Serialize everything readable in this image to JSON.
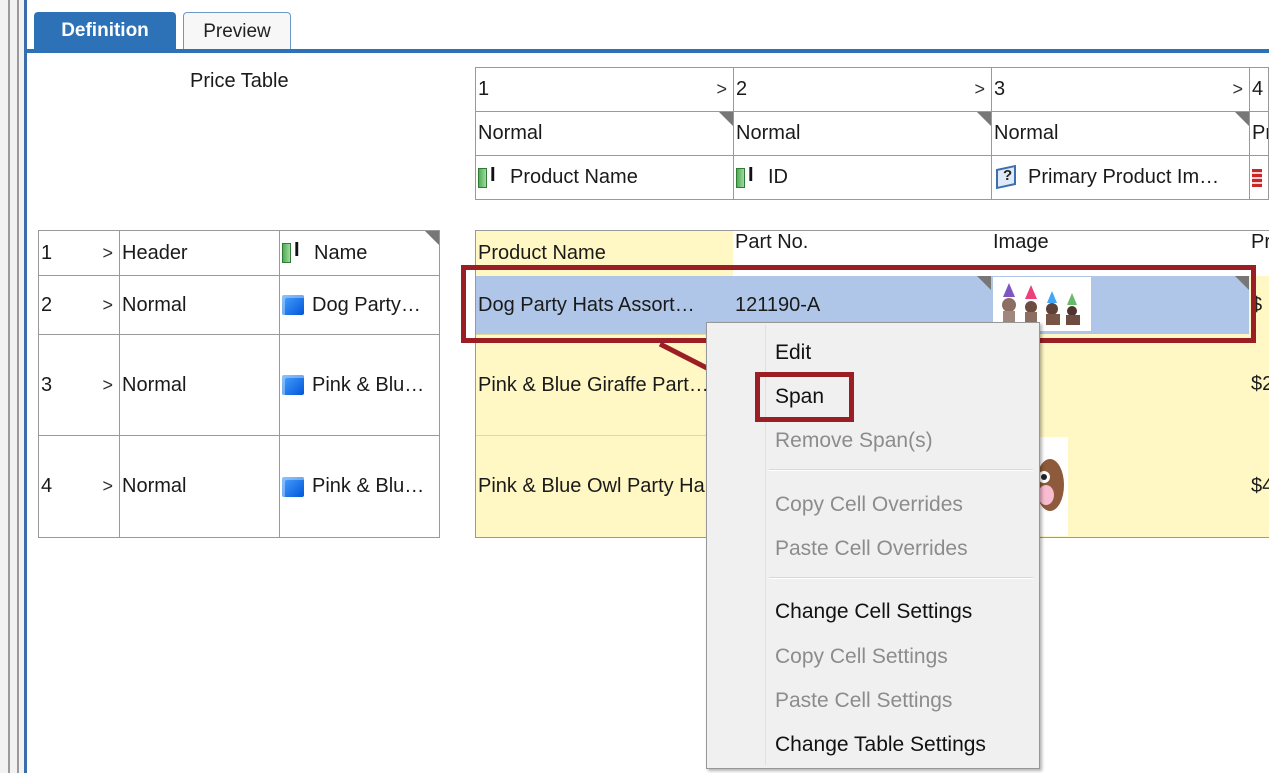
{
  "tabs": [
    {
      "label": "Definition",
      "active": true
    },
    {
      "label": "Preview",
      "active": false
    }
  ],
  "price_table_label": "Price Table",
  "columns": [
    {
      "num": "1",
      "style": "Normal",
      "field": "Product Name",
      "field_icon": "text-field-icon"
    },
    {
      "num": "2",
      "style": "Normal",
      "field": "ID",
      "field_icon": "text-field-icon"
    },
    {
      "num": "3",
      "style": "Normal",
      "field": "Primary Product Im…",
      "field_icon": "image-field-icon"
    },
    {
      "num": "4",
      "style": "Pr",
      "field": "",
      "field_icon": "table-icon"
    }
  ],
  "row_defs": [
    {
      "num": "1",
      "style": "Header",
      "name": "Name",
      "icon": "text-field-icon"
    },
    {
      "num": "2",
      "style": "Normal",
      "name": "Dog Party…",
      "icon": "cube-icon"
    },
    {
      "num": "3",
      "style": "Normal",
      "name": "Pink & Blu…",
      "icon": "cube-icon"
    },
    {
      "num": "4",
      "style": "Normal",
      "name": "Pink & Blu…",
      "icon": "cube-icon"
    }
  ],
  "grid": {
    "header": [
      "Product Name",
      "Part No.",
      "Image",
      "Pr"
    ],
    "rows": [
      [
        "Dog Party Hats Assort…",
        "121190-A",
        "",
        "$"
      ],
      [
        "Pink & Blue Giraffe Part…",
        "",
        "",
        "$2"
      ],
      [
        "Pink & Blue Owl Party Ha",
        "",
        "",
        "$4"
      ]
    ]
  },
  "context_menu": {
    "items": [
      {
        "label": "Edit",
        "enabled": true
      },
      {
        "label": "Span",
        "enabled": true
      },
      {
        "label": "Remove Span(s)",
        "enabled": false
      },
      {
        "label": "Copy Cell Overrides",
        "enabled": false
      },
      {
        "label": "Paste Cell Overrides",
        "enabled": false
      },
      {
        "label": "Change Cell Settings",
        "enabled": true
      },
      {
        "label": "Copy Cell Settings",
        "enabled": false
      },
      {
        "label": "Paste Cell Settings",
        "enabled": false
      },
      {
        "label": "Change Table Settings",
        "enabled": true
      }
    ]
  },
  "colors": {
    "tab_active": "#2d72b6",
    "highlight": "#9c1e25",
    "cell_yellow": "#fff7c4",
    "cell_selected": "#afc6e9"
  }
}
